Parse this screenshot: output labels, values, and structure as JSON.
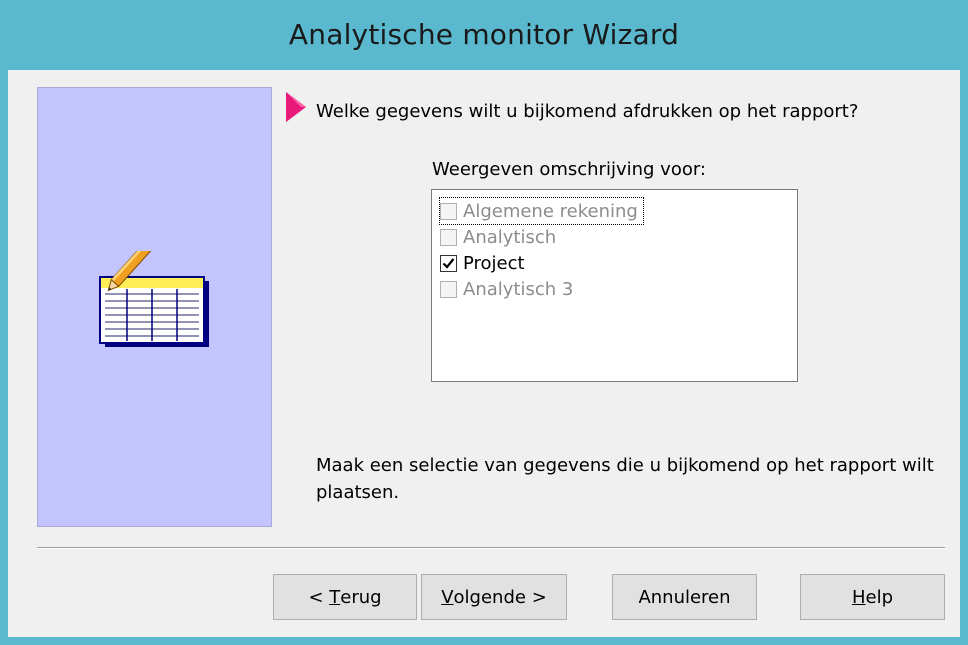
{
  "window": {
    "title": "Analytische monitor Wizard",
    "title_bar_color": "#5ab9cf",
    "client_color": "#f0f0f0"
  },
  "side_panel": {
    "color": "#c4c4ff",
    "icon": "table-with-pencil-icon"
  },
  "step_arrow": {
    "icon": "pointer-arrow-icon",
    "color": "#e8197a"
  },
  "question": "Welke gegevens wilt u bijkomend afdrukken op het rapport?",
  "list": {
    "label": "Weergeven omschrijving voor:",
    "items": [
      {
        "label": "Algemene rekening",
        "checked": false,
        "enabled": false,
        "focused": true
      },
      {
        "label": "Analytisch",
        "checked": false,
        "enabled": false,
        "focused": false
      },
      {
        "label": "Project",
        "checked": true,
        "enabled": true,
        "focused": false
      },
      {
        "label": "Analytisch 3",
        "checked": false,
        "enabled": false,
        "focused": false
      }
    ]
  },
  "hint": "Maak een selectie van gegevens die u bijkomend op het rapport wilt plaatsen.",
  "buttons": {
    "back": {
      "prefix": "< ",
      "mnemonic": "T",
      "rest": "erug"
    },
    "next": {
      "mnemonic": "V",
      "rest": "olgende >"
    },
    "cancel": {
      "label": "Annuleren"
    },
    "help": {
      "mnemonic": "H",
      "rest": "elp"
    }
  }
}
